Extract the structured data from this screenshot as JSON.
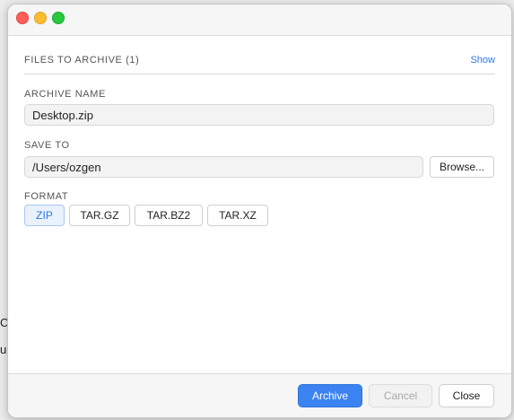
{
  "background": {
    "fragment_1": "C",
    "fragment_2": "u"
  },
  "files": {
    "label": "FILES TO ARCHIVE (1)",
    "show_link": "Show"
  },
  "archive_name": {
    "label": "ARCHIVE NAME",
    "value": "Desktop.zip"
  },
  "save_to": {
    "label": "SAVE TO",
    "value": "/Users/ozgen",
    "browse_label": "Browse..."
  },
  "format": {
    "label": "FORMAT",
    "options": [
      "ZIP",
      "TAR.GZ",
      "TAR.BZ2",
      "TAR.XZ"
    ],
    "selected": "ZIP"
  },
  "footer": {
    "archive_label": "Archive",
    "cancel_label": "Cancel",
    "close_label": "Close"
  },
  "colors": {
    "accent": "#3a83f1",
    "selected_bg": "#e9f1fd",
    "link": "#2f78e6"
  }
}
